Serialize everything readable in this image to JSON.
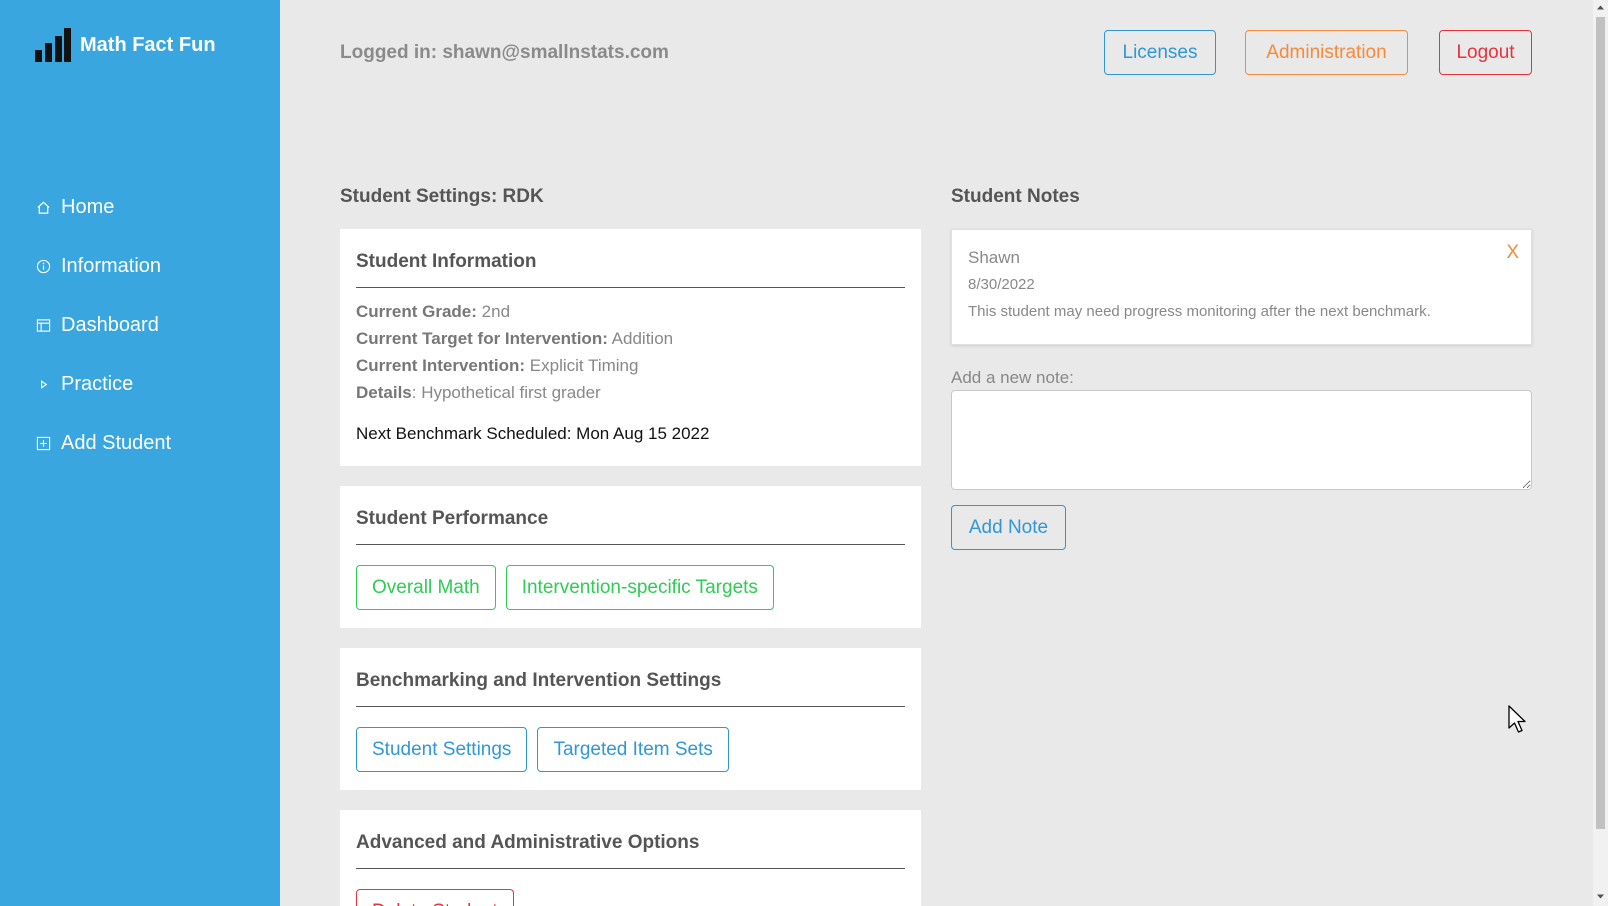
{
  "app": {
    "name": "Math Fact Fun"
  },
  "sidebar": {
    "items": [
      {
        "label": "Home",
        "icon": "home-icon"
      },
      {
        "label": "Information",
        "icon": "info-icon"
      },
      {
        "label": "Dashboard",
        "icon": "dashboard-icon"
      },
      {
        "label": "Practice",
        "icon": "play-icon"
      },
      {
        "label": "Add Student",
        "icon": "plus-square-icon"
      }
    ]
  },
  "header": {
    "logged_in": "Logged in: shawn@smallnstats.com",
    "licenses_label": "Licenses",
    "administration_label": "Administration",
    "logout_label": "Logout"
  },
  "settings": {
    "title": "Student Settings: RDK",
    "info_card": {
      "heading": "Student Information",
      "grade_label": "Current Grade:",
      "grade_value": "2nd",
      "target_label": "Current Target for Intervention:",
      "target_value": "Addition",
      "intervention_label": "Current Intervention:",
      "intervention_value": "Explicit Timing",
      "details_label": "Details",
      "details_value": ": Hypothetical first grader",
      "benchmark": "Next Benchmark Scheduled: Mon Aug 15 2022"
    },
    "performance_card": {
      "heading": "Student Performance",
      "overall_label": "Overall Math",
      "targets_label": "Intervention-specific Targets"
    },
    "benchmark_card": {
      "heading": "Benchmarking and Intervention Settings",
      "settings_label": "Student Settings",
      "itemsets_label": "Targeted Item Sets"
    },
    "advanced_card": {
      "heading": "Advanced and Administrative Options",
      "delete_label": "Delete Student"
    }
  },
  "notes": {
    "title": "Student Notes",
    "items": [
      {
        "author": "Shawn",
        "date": "8/30/2022",
        "text": "This student may need progress monitoring after the next benchmark.",
        "close": "X"
      }
    ],
    "add_label": "Add a new note:",
    "input_value": "",
    "add_button": "Add Note"
  },
  "colors": {
    "sidebar": "#39a6df",
    "background": "#e9e9e9",
    "blue": "#2f97d8",
    "orange": "#f58a3b",
    "red": "#e8323c",
    "green": "#2ecc55"
  }
}
